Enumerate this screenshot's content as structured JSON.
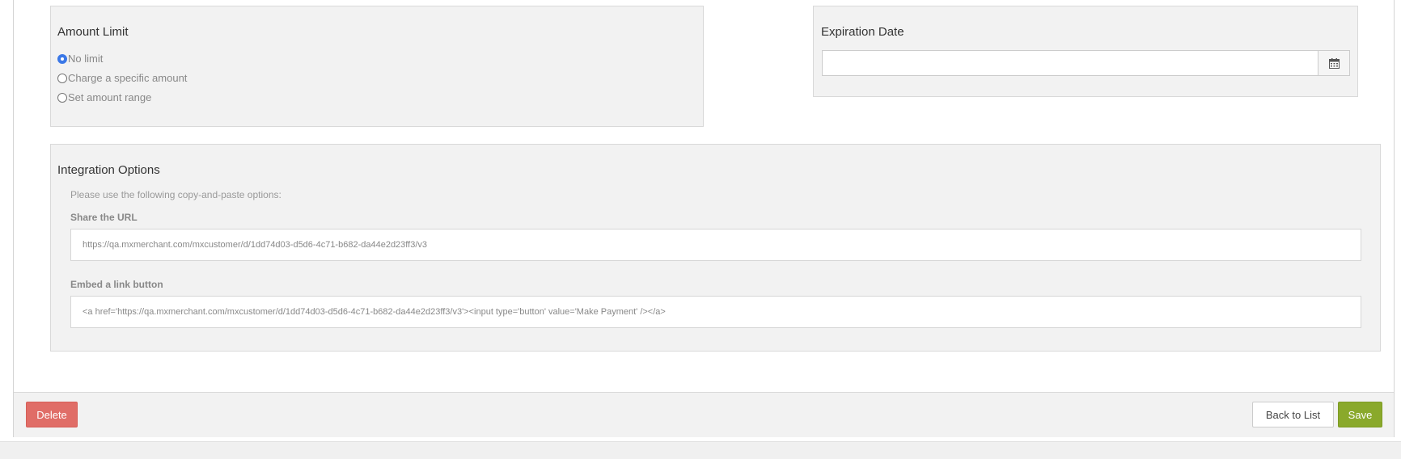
{
  "amount_limit": {
    "title": "Amount Limit",
    "options": [
      {
        "label": "No limit",
        "checked": true
      },
      {
        "label": "Charge a specific amount",
        "checked": false
      },
      {
        "label": "Set amount range",
        "checked": false
      }
    ]
  },
  "expiration": {
    "title": "Expiration Date",
    "value": "",
    "calendar_icon": "calendar-icon"
  },
  "integration": {
    "title": "Integration Options",
    "instructions": "Please use the following copy-and-paste options:",
    "share_label": "Share the URL",
    "share_url": "https://qa.mxmerchant.com/mxcustomer/d/1dd74d03-d5d6-4c71-b682-da44e2d23ff3/v3",
    "embed_label": "Embed a link button",
    "embed_code": "<a href='https://qa.mxmerchant.com/mxcustomer/d/1dd74d03-d5d6-4c71-b682-da44e2d23ff3/v3'><input type='button' value='Make Payment' /></a>"
  },
  "footer": {
    "delete_label": "Delete",
    "back_label": "Back to List",
    "save_label": "Save"
  },
  "colors": {
    "delete": "#e06d67",
    "save": "#8aa92b",
    "radio_checked": "#3b78e7"
  }
}
